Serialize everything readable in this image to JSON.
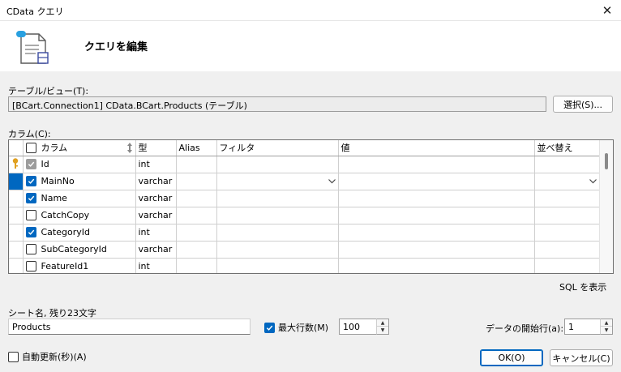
{
  "window": {
    "title": "CData クエリ",
    "close_glyph": "✕"
  },
  "header": {
    "heading": "クエリを編集",
    "icon": "document-sql-icon"
  },
  "table_section": {
    "label": "テーブル/ビュー(T):",
    "value": "[BCart.Connection1] CData.BCart.Products (テーブル)",
    "select_button": "選択(S)..."
  },
  "columns_section": {
    "label": "カラム(C):",
    "headers": {
      "column": "カラム",
      "type": "型",
      "alias": "Alias",
      "filter": "フィルタ",
      "value": "値",
      "sort": "並べ替え"
    },
    "rows": [
      {
        "name": "Id",
        "type": "int",
        "checked": true,
        "disabled": true,
        "key": true,
        "selected": false
      },
      {
        "name": "MainNo",
        "type": "varchar",
        "checked": true,
        "disabled": false,
        "key": false,
        "selected": true
      },
      {
        "name": "Name",
        "type": "varchar",
        "checked": true,
        "disabled": false,
        "key": false,
        "selected": false
      },
      {
        "name": "CatchCopy",
        "type": "varchar",
        "checked": false,
        "disabled": false,
        "key": false,
        "selected": false
      },
      {
        "name": "CategoryId",
        "type": "int",
        "checked": true,
        "disabled": false,
        "key": false,
        "selected": false
      },
      {
        "name": "SubCategoryId",
        "type": "varchar",
        "checked": false,
        "disabled": false,
        "key": false,
        "selected": false
      },
      {
        "name": "FeatureId1",
        "type": "int",
        "checked": false,
        "disabled": false,
        "key": false,
        "selected": false
      }
    ]
  },
  "show_sql": "SQL を表示",
  "sheet": {
    "label": "シート名, 残り23文字",
    "value": "Products"
  },
  "max_rows": {
    "label": "最大行数(M)",
    "checked": true,
    "value": "100"
  },
  "start_row": {
    "label": "データの開始行(a):",
    "value": "1"
  },
  "auto_refresh": {
    "label": "自動更新(秒)(A)",
    "checked": false
  },
  "buttons": {
    "ok": "OK(O)",
    "cancel": "キャンセル(C)"
  },
  "colors": {
    "accent": "#0067c0",
    "key_icon": "#e0a020"
  }
}
